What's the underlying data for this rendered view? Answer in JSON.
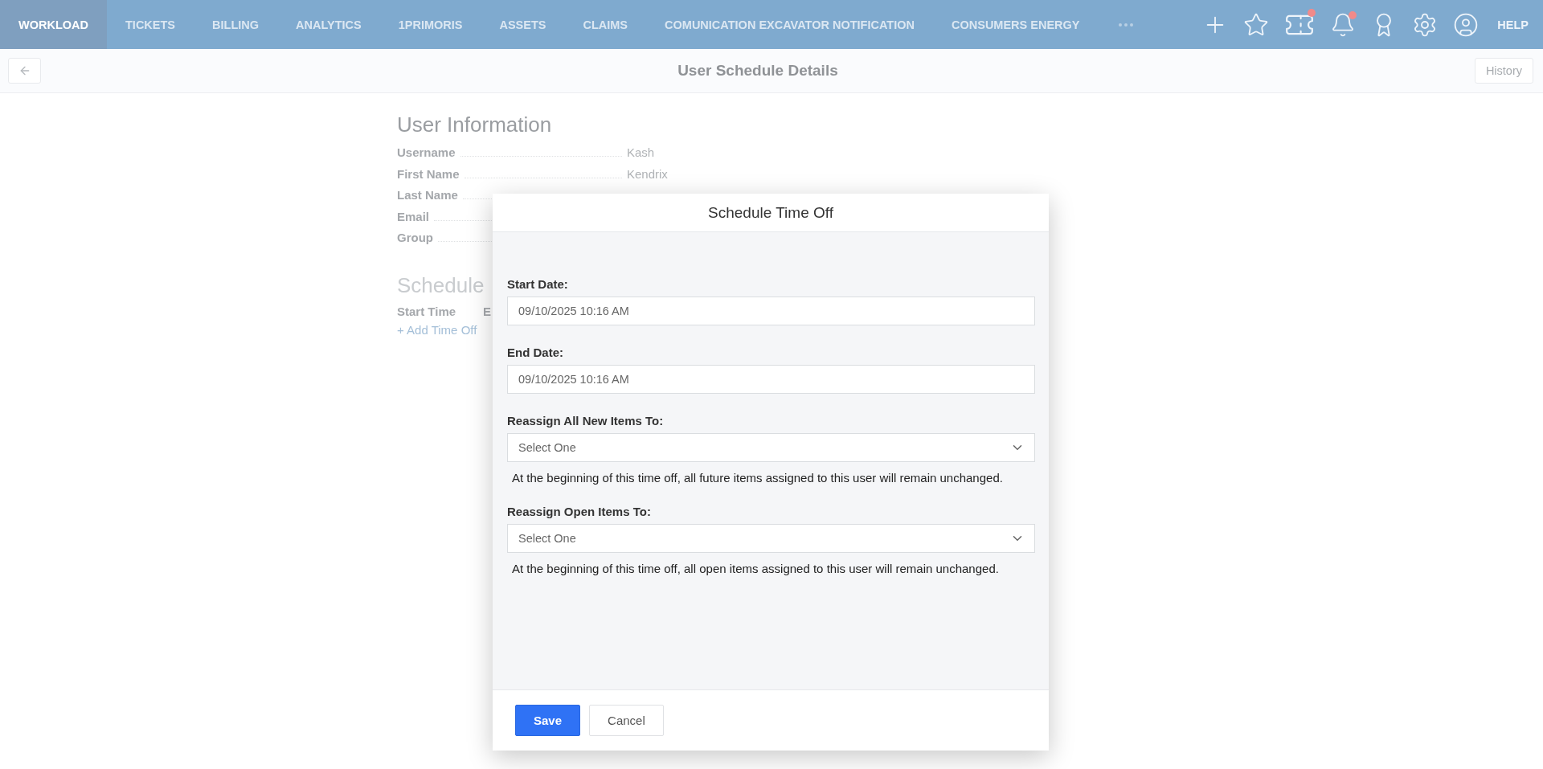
{
  "nav": {
    "items": [
      {
        "label": "WORKLOAD",
        "selected": true
      },
      {
        "label": "TICKETS",
        "selected": false
      },
      {
        "label": "BILLING",
        "selected": false
      },
      {
        "label": "ANALYTICS",
        "selected": false
      },
      {
        "label": "1PRIMORIS",
        "selected": false
      },
      {
        "label": "ASSETS",
        "selected": false
      },
      {
        "label": "CLAIMS",
        "selected": false
      },
      {
        "label": "COMUNICATION EXCAVATOR NOTIFICATION",
        "selected": false
      },
      {
        "label": "CONSUMERS ENERGY",
        "selected": false
      }
    ],
    "tools": [
      {
        "kind": "plus",
        "badge": false
      },
      {
        "kind": "star",
        "badge": false
      },
      {
        "kind": "ticket",
        "badge": true
      },
      {
        "kind": "bell",
        "badge": true
      },
      {
        "kind": "award",
        "badge": false
      },
      {
        "kind": "settings",
        "badge": false
      },
      {
        "kind": "user",
        "badge": false
      }
    ],
    "help": "HELP"
  },
  "header": {
    "title": "User Schedule Details",
    "history_button": "History"
  },
  "user_information": {
    "title": "User Information",
    "rows": [
      {
        "label": "Username",
        "value": "Kash"
      },
      {
        "label": "First Name",
        "value": "Kendrix"
      },
      {
        "label": "Last Name"
      },
      {
        "label": "Email"
      },
      {
        "label": "Group"
      }
    ]
  },
  "scheduled": {
    "title": "Schedule",
    "columns": [
      "Start Time",
      "E"
    ],
    "add_link": "+ Add Time Off"
  },
  "dialog": {
    "title": "Schedule Time Off",
    "fields": [
      {
        "kind": "date",
        "label": "Start Date:",
        "value": "09/10/2025 10:16 AM"
      },
      {
        "kind": "date",
        "label": "End Date:",
        "value": "09/10/2025 10:16 AM"
      },
      {
        "kind": "select",
        "label": "Reassign All New Items To:",
        "value": "Select One",
        "help": "At the beginning of this time off, all future items assigned to this user will remain unchanged."
      },
      {
        "kind": "select",
        "label": "Reassign Open Items To:",
        "value": "Select One",
        "help": "At the beginning of this time off, all open items assigned to this user will remain unchanged."
      }
    ],
    "buttons": [
      {
        "kind": "primary",
        "label": "Save"
      },
      {
        "kind": "secondary",
        "label": "Cancel"
      }
    ]
  }
}
